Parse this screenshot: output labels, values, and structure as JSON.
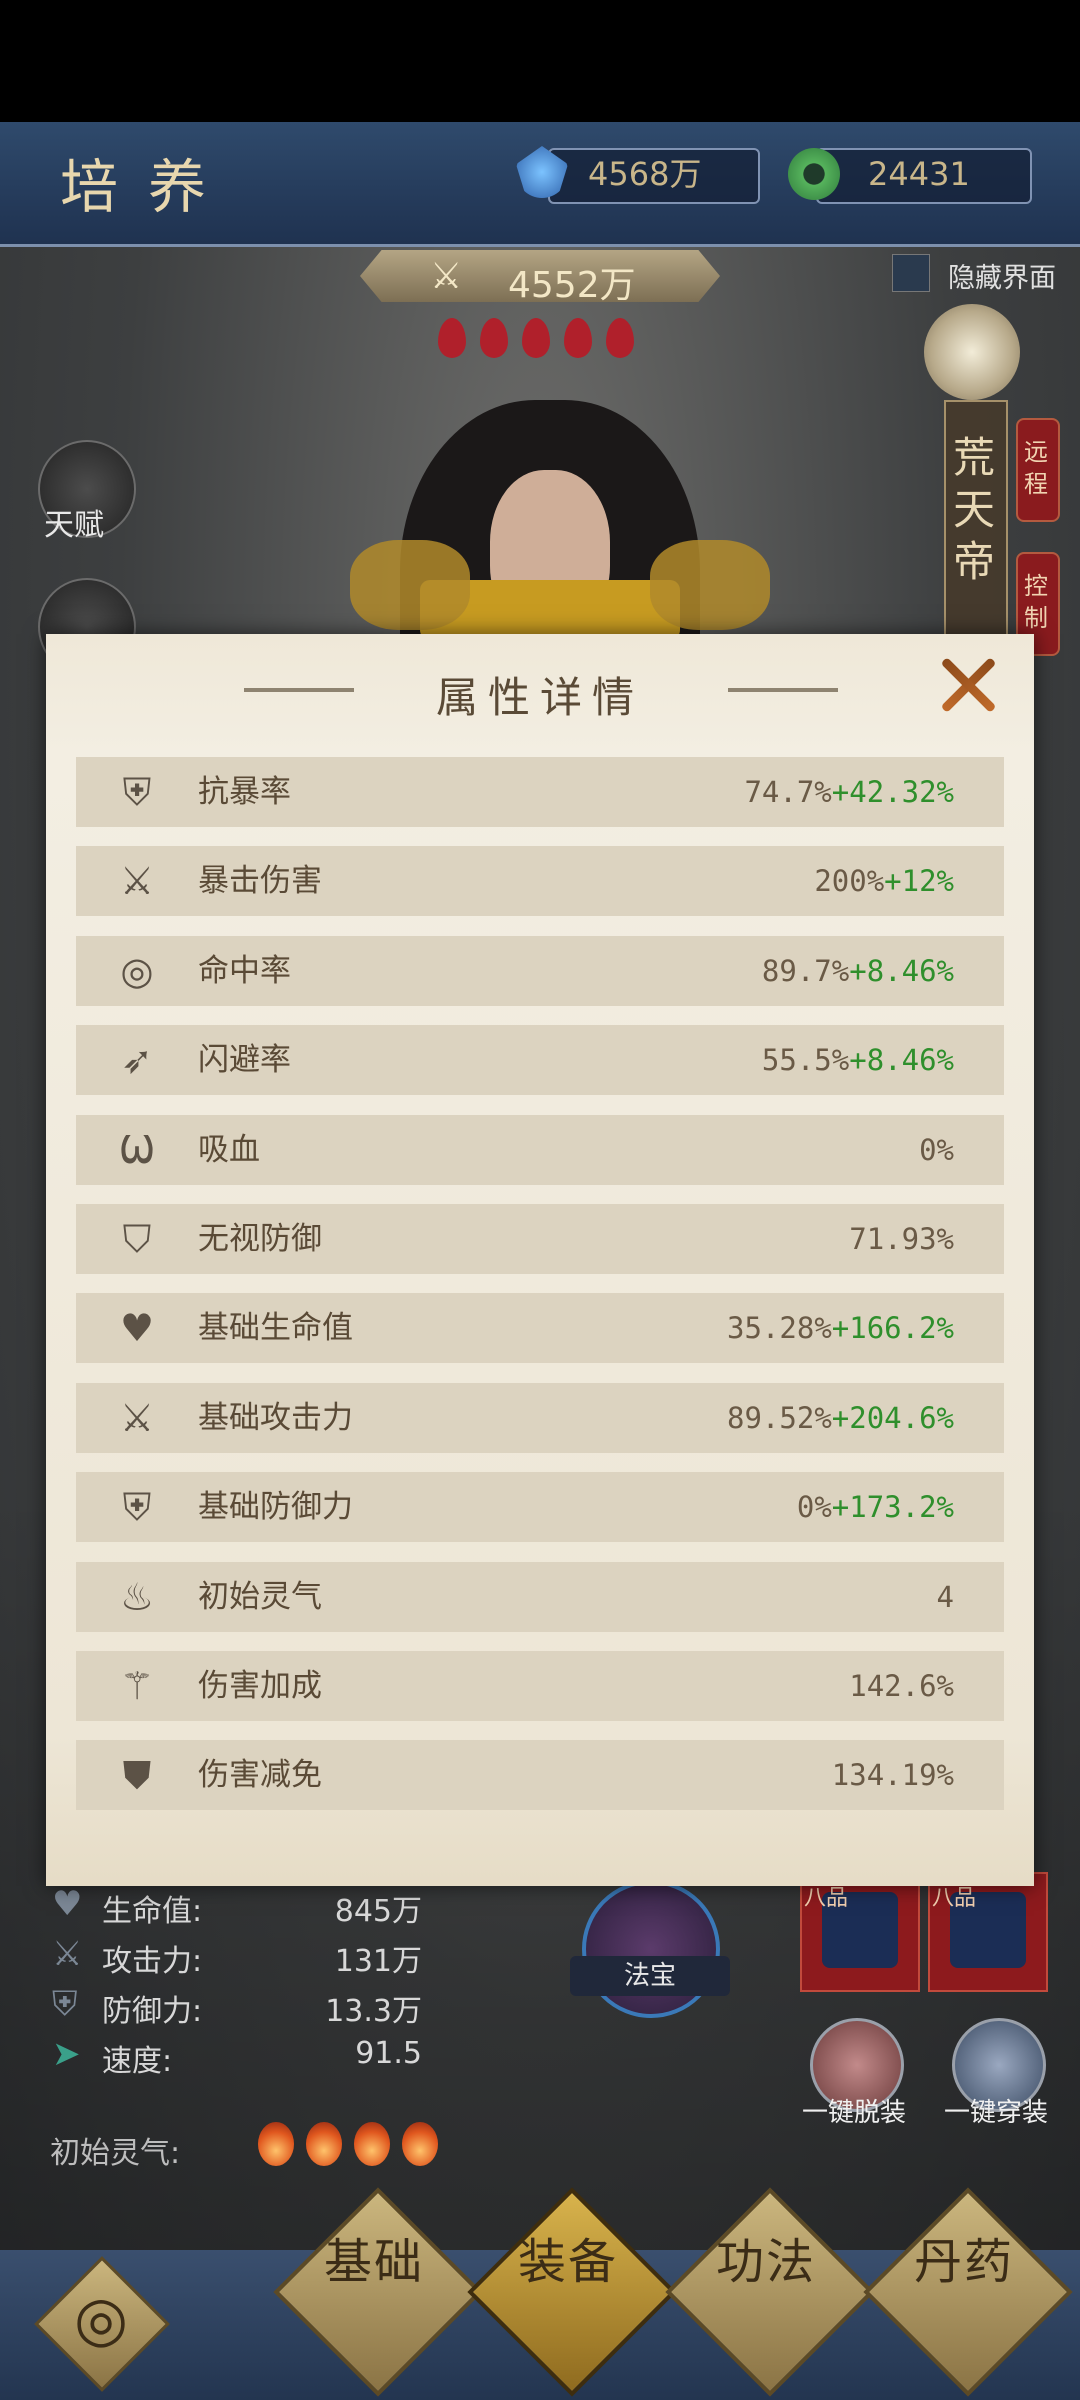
{
  "header": {
    "title": "培养",
    "currency_crystal": "4568万",
    "currency_jade": "24431",
    "power": "4552万",
    "hide_ui_label": "隐藏界面"
  },
  "character": {
    "name": "荒天帝",
    "tab_remote": "远程",
    "tab_control": "控制"
  },
  "left_menu": {
    "talent_label": "天赋"
  },
  "dialog": {
    "title": "属性详情",
    "rows": [
      {
        "label": "抗暴率",
        "base": "74.7%",
        "bonus": "+42.32%",
        "icon": "shield-icon"
      },
      {
        "label": "暴击伤害",
        "base": "200%",
        "bonus": "+12%",
        "icon": "crossed-sword-icon"
      },
      {
        "label": "命中率",
        "base": "89.7%",
        "bonus": "+8.46%",
        "icon": "target-icon"
      },
      {
        "label": "闪避率",
        "base": "55.5%",
        "bonus": "+8.46%",
        "icon": "wing-icon"
      },
      {
        "label": "吸血",
        "base": "0%",
        "bonus": "",
        "icon": "fang-icon"
      },
      {
        "label": "无视防御",
        "base": "71.93%",
        "bonus": "",
        "icon": "broken-shield-icon"
      },
      {
        "label": "基础生命值",
        "base": "35.28%",
        "bonus": "+166.2%",
        "icon": "heart-plus-icon"
      },
      {
        "label": "基础攻击力",
        "base": "89.52%",
        "bonus": "+204.6%",
        "icon": "sword-plus-icon"
      },
      {
        "label": "基础防御力",
        "base": "0%",
        "bonus": "+173.2%",
        "icon": "shield-plus-icon"
      },
      {
        "label": "初始灵气",
        "base": "4",
        "bonus": "",
        "icon": "flame-icon"
      },
      {
        "label": "伤害加成",
        "base": "142.6%",
        "bonus": "",
        "icon": "sword-up-icon"
      },
      {
        "label": "伤害减免",
        "base": "134.19%",
        "bonus": "",
        "icon": "shield-down-icon"
      }
    ]
  },
  "base_stats": [
    {
      "label": "生命值:",
      "value": "845万"
    },
    {
      "label": "攻击力:",
      "value": "131万"
    },
    {
      "label": "防御力:",
      "value": "13.3万"
    },
    {
      "label": "速度:",
      "value": "91.5"
    }
  ],
  "initial_spirit_label": "初始灵气:",
  "treasure_label": "法宝",
  "gear_tags": [
    "八品",
    "八品"
  ],
  "actions": {
    "unequip_all": "一键脱装",
    "equip_all": "一键穿装"
  },
  "bottom_nav": [
    {
      "label": "基础"
    },
    {
      "label": "装备"
    },
    {
      "label": "功法"
    },
    {
      "label": "丹药"
    }
  ],
  "colors": {
    "bonus_green": "#2f8f2c",
    "label_brown": "#5a4a36",
    "row_bg": "#dcd3c0"
  }
}
